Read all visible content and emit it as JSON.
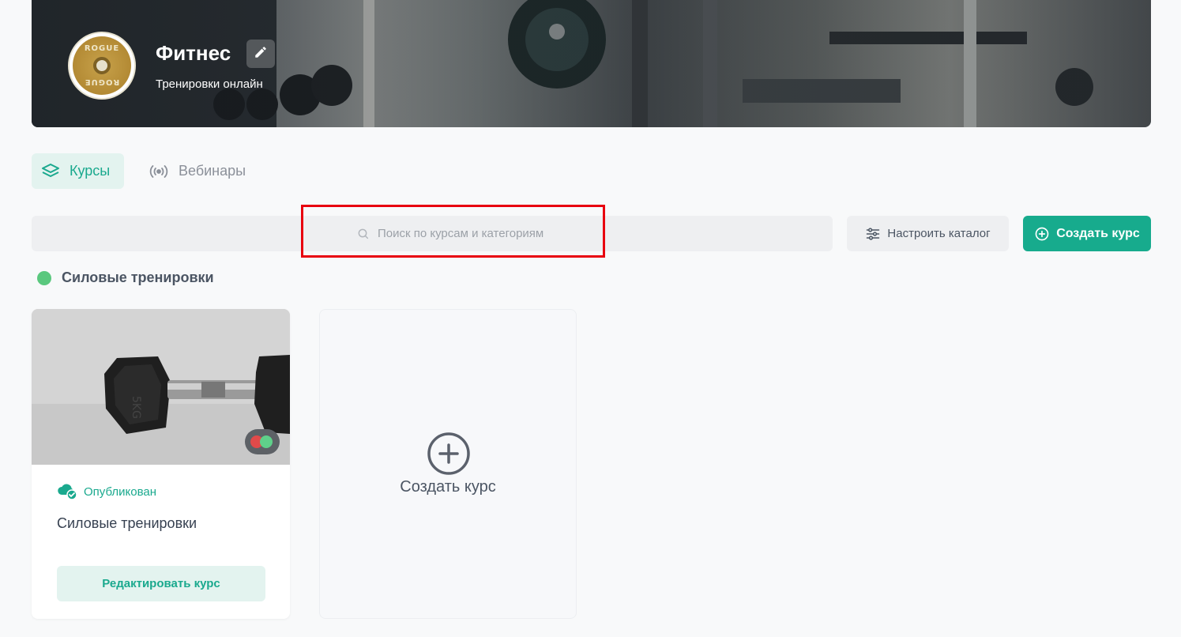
{
  "header": {
    "title": "Фитнес",
    "subtitle": "Тренировки онлайн",
    "avatar_text_top": "ROGUE",
    "avatar_text_bottom": "ROGUE"
  },
  "tabs": [
    {
      "label": "Курсы",
      "icon": "layers-icon",
      "active": true
    },
    {
      "label": "Вебинары",
      "icon": "broadcast-icon",
      "active": false
    }
  ],
  "search": {
    "placeholder": "Поиск по курсам и категориям"
  },
  "toolbar": {
    "configure_label": "Настроить каталог",
    "create_label": "Создать курс"
  },
  "category": {
    "name": "Силовые тренировки",
    "color": "#5ac87e"
  },
  "courses": [
    {
      "status": "Опубликован",
      "title": "Силовые тренировки",
      "edit_label": "Редактировать курс",
      "image_text": "5KG"
    }
  ],
  "add_card": {
    "label": "Создать курс"
  },
  "colors": {
    "accent": "#17ab8d",
    "highlight": "#e8000f"
  }
}
